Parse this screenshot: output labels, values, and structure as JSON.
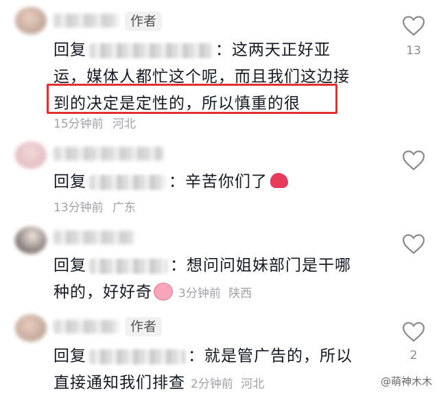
{
  "comments": [
    {
      "author_tag": "作者",
      "reply_prefix": "回复",
      "text_line1": "：这两天正好亚",
      "text_line2": "运，媒体人都忙这个呢，而且我们这边接",
      "text_line3": "到的决定是定性的，所以慎重的很",
      "time": "15分钟前",
      "location": "河北",
      "likes": "13"
    },
    {
      "reply_prefix": "回复",
      "text": "：辛苦你们了",
      "emoji": "muscle-emoji",
      "time": "13分钟前",
      "location": "广东"
    },
    {
      "reply_prefix": "回复",
      "text_line1": "：想问问姐妹部门是干哪",
      "text_line2": "种的，好好奇",
      "emoji": "surprised-face-emoji",
      "time": "3分钟前",
      "location": "陕西"
    },
    {
      "author_tag": "作者",
      "reply_prefix": "回复",
      "text_line1": "：就是管广告的，所以",
      "text_line2": "直接通知我们排查",
      "time": "2分钟前",
      "location": "河北",
      "likes": "2"
    }
  ],
  "watermark": "@萌神木木",
  "colors": {
    "highlight_box": "#e23030",
    "meta": "#a0a0a6",
    "text": "#161823"
  }
}
